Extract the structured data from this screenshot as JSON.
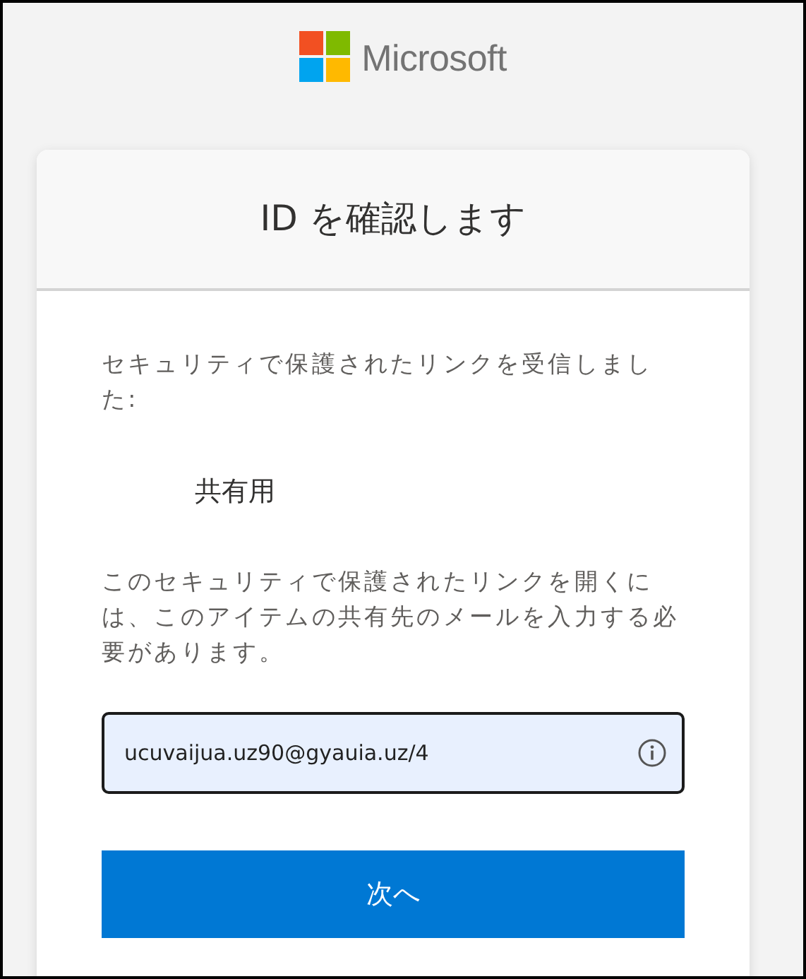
{
  "brand": {
    "name": "Microsoft"
  },
  "card": {
    "title": "ID を確認します",
    "intro": "セキュリティで保護されたリンクを受信しました:",
    "item_name": "共有用",
    "instructions": "このセキュリティで保護されたリンクを開くには、このアイテムの共有先のメールを入力する必要があります。",
    "email_field": {
      "value": "ucuvaijua.uz90@gyauia.uz/4",
      "focused": true
    },
    "next_button": "次へ"
  }
}
